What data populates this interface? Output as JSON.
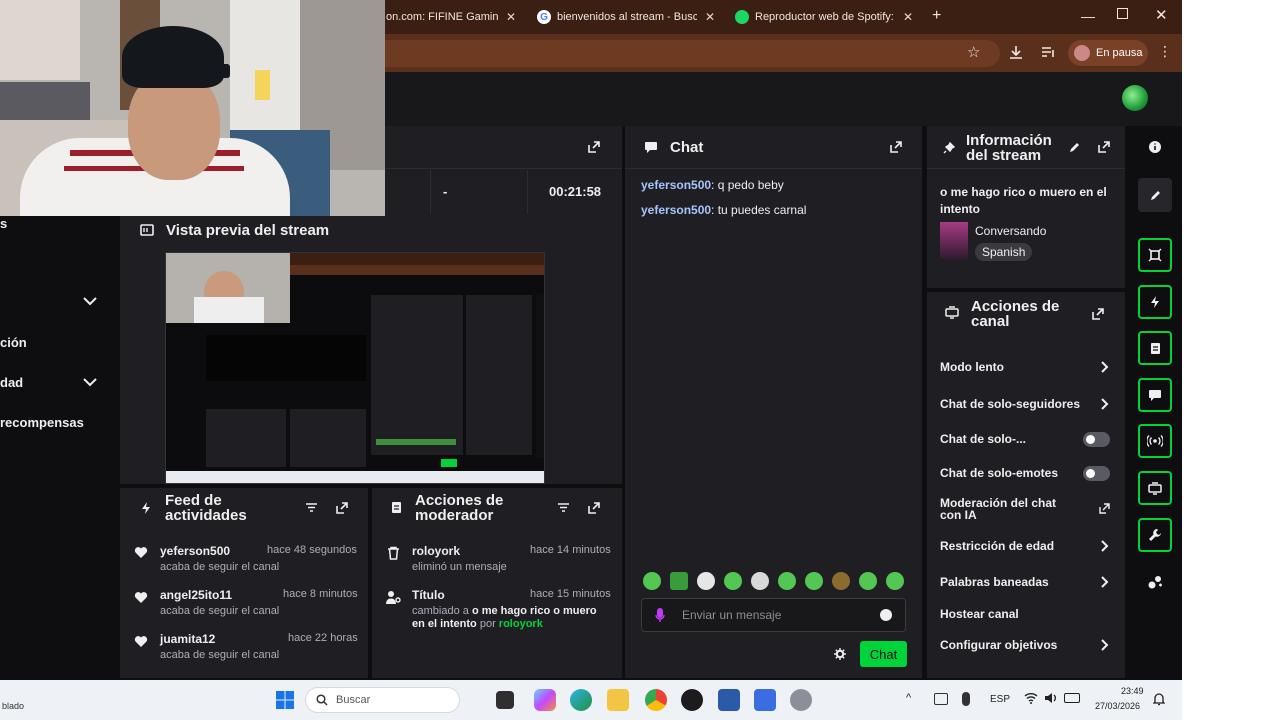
{
  "browser": {
    "tabs": [
      {
        "label": "on.com: FIFINE Gaming P",
        "fav_color": "#f2f2f2"
      },
      {
        "label": "bienvenidos al stream - Buscar",
        "fav_color": "#f2f2f2"
      },
      {
        "label": "Reproductor web de Spotify: m",
        "fav_color": "#1ed760"
      }
    ],
    "new_tab": "+",
    "profile_label": "En pausa"
  },
  "stats": {
    "dash": "-",
    "timer": "00:21:58"
  },
  "left_nav": {
    "items": [
      "s",
      "ción",
      "dad",
      "recompensas"
    ]
  },
  "preview": {
    "title": "Vista previa del stream"
  },
  "feed": {
    "title_line1": "Feed de",
    "title_line2": "actividades",
    "rows": [
      {
        "user": "yeferson500",
        "time": "hace 48 segundos",
        "desc": "acaba de seguir el canal"
      },
      {
        "user": "angel25ito11",
        "time": "hace 8 minutos",
        "desc": "acaba de seguir el canal"
      },
      {
        "user": "juamita12",
        "time": "hace 22 horas",
        "desc": "acaba de seguir el canal"
      }
    ]
  },
  "mod_actions": {
    "title_line1": "Acciones de",
    "title_line2": "moderador",
    "rows": [
      {
        "user": "roloyork",
        "time": "hace 14 minutos",
        "desc": "eliminó un mensaje"
      },
      {
        "user": "Título",
        "time": "hace 15 minutos",
        "desc_pre": "cambiado a ",
        "desc_bold": "o me hago rico o muero en el intento",
        "desc_mid": " por ",
        "desc_user": "roloyork"
      }
    ]
  },
  "chat": {
    "title": "Chat",
    "messages": [
      {
        "user": "yeferson500",
        "text": "q pedo beby"
      },
      {
        "user": "yeferson500",
        "text": "tu puedes carnal"
      }
    ],
    "input_placeholder": "Enviar un mensaje",
    "send_label": "Chat"
  },
  "info": {
    "title_line1": "Información",
    "title_line2": "del stream",
    "stream_title": "o me hago rico o muero en el intento",
    "category": "Conversando",
    "language": "Spanish"
  },
  "channel_actions": {
    "title_line1": "Acciones de",
    "title_line2": "canal",
    "items": [
      {
        "label": "Modo lento",
        "control": "chevron"
      },
      {
        "label": "Chat de solo-seguidores",
        "control": "chevron"
      },
      {
        "label": "Chat de solo-...",
        "control": "toggle"
      },
      {
        "label": "Chat de solo-emotes",
        "control": "toggle"
      },
      {
        "label": "Moderación del chat con IA",
        "control": "external"
      },
      {
        "label": "Restricción de edad",
        "control": "chevron"
      },
      {
        "label": "Palabras baneadas",
        "control": "chevron"
      },
      {
        "label": "Hostear canal",
        "control": "none"
      },
      {
        "label": "Configurar objetivos",
        "control": "chevron"
      }
    ]
  },
  "taskbar": {
    "left_text": "blado",
    "search_placeholder": "Buscar",
    "lang": "ESP",
    "time": "23:49",
    "date": "27/03/2026"
  },
  "colors": {
    "accent": "#00d43b",
    "chrome": "#3a1f12",
    "panel": "#1f1f23"
  }
}
